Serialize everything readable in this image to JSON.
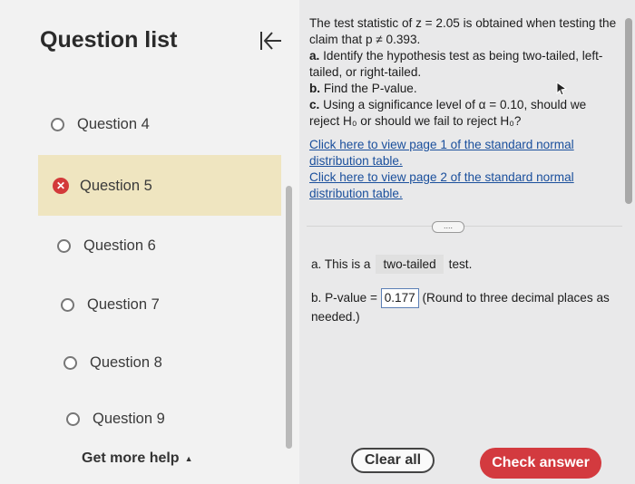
{
  "sidebar": {
    "title": "Question list",
    "items": [
      {
        "label": "Question 4"
      },
      {
        "label": "Question 5"
      },
      {
        "label": "Question 6"
      },
      {
        "label": "Question 7"
      },
      {
        "label": "Question 8"
      },
      {
        "label": "Question 9"
      }
    ],
    "help_label": "Get more help",
    "help_caret": "▲"
  },
  "question": {
    "line1": "The test statistic of z = 2.05 is obtained when testing the claim that p ≠ 0.393.",
    "a_label": "a.",
    "a_text": "Identify the hypothesis test as being two-tailed, left-tailed, or right-tailed.",
    "b_label": "b.",
    "b_text": "Find the P-value.",
    "c_label": "c.",
    "c_text": "Using a significance level of α = 0.10, should we reject H₀ or should we fail to reject H₀?",
    "link1": "Click here to view page 1 of the standard normal distribution table.",
    "link2": "Click here to view page 2 of the standard normal distribution table."
  },
  "more_button": "....",
  "answer_a": {
    "prefix": "a. This is a",
    "value": "two-tailed",
    "suffix": "test."
  },
  "answer_b": {
    "prefix": "b. P-value =",
    "value": "0.177",
    "suffix": "(Round to three decimal places as needed.)"
  },
  "buttons": {
    "clear": "Clear all",
    "check": "Check answer"
  },
  "colors": {
    "accent": "#d33a3f",
    "selected_bg": "#efe5c0",
    "link": "#1a4f9c"
  }
}
